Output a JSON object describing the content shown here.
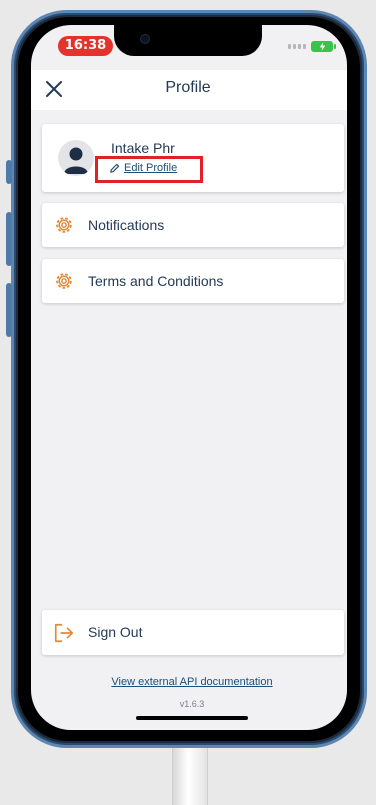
{
  "status_bar": {
    "time": "16:38"
  },
  "header": {
    "title": "Profile"
  },
  "profile": {
    "name": "Intake Phr",
    "edit_label": "Edit Profile"
  },
  "menu": {
    "notifications_label": "Notifications",
    "terms_label": "Terms and Conditions"
  },
  "sign_out": {
    "label": "Sign Out"
  },
  "footer": {
    "api_link": "View external API documentation",
    "version": "v1.6.3"
  },
  "colors": {
    "accent_orange": "#e0893a",
    "text_navy": "#243a55",
    "link_blue": "#1d4f78",
    "highlight_red": "#e2202a",
    "status_time_bg": "#e4322c",
    "battery_green": "#3cc24a"
  }
}
